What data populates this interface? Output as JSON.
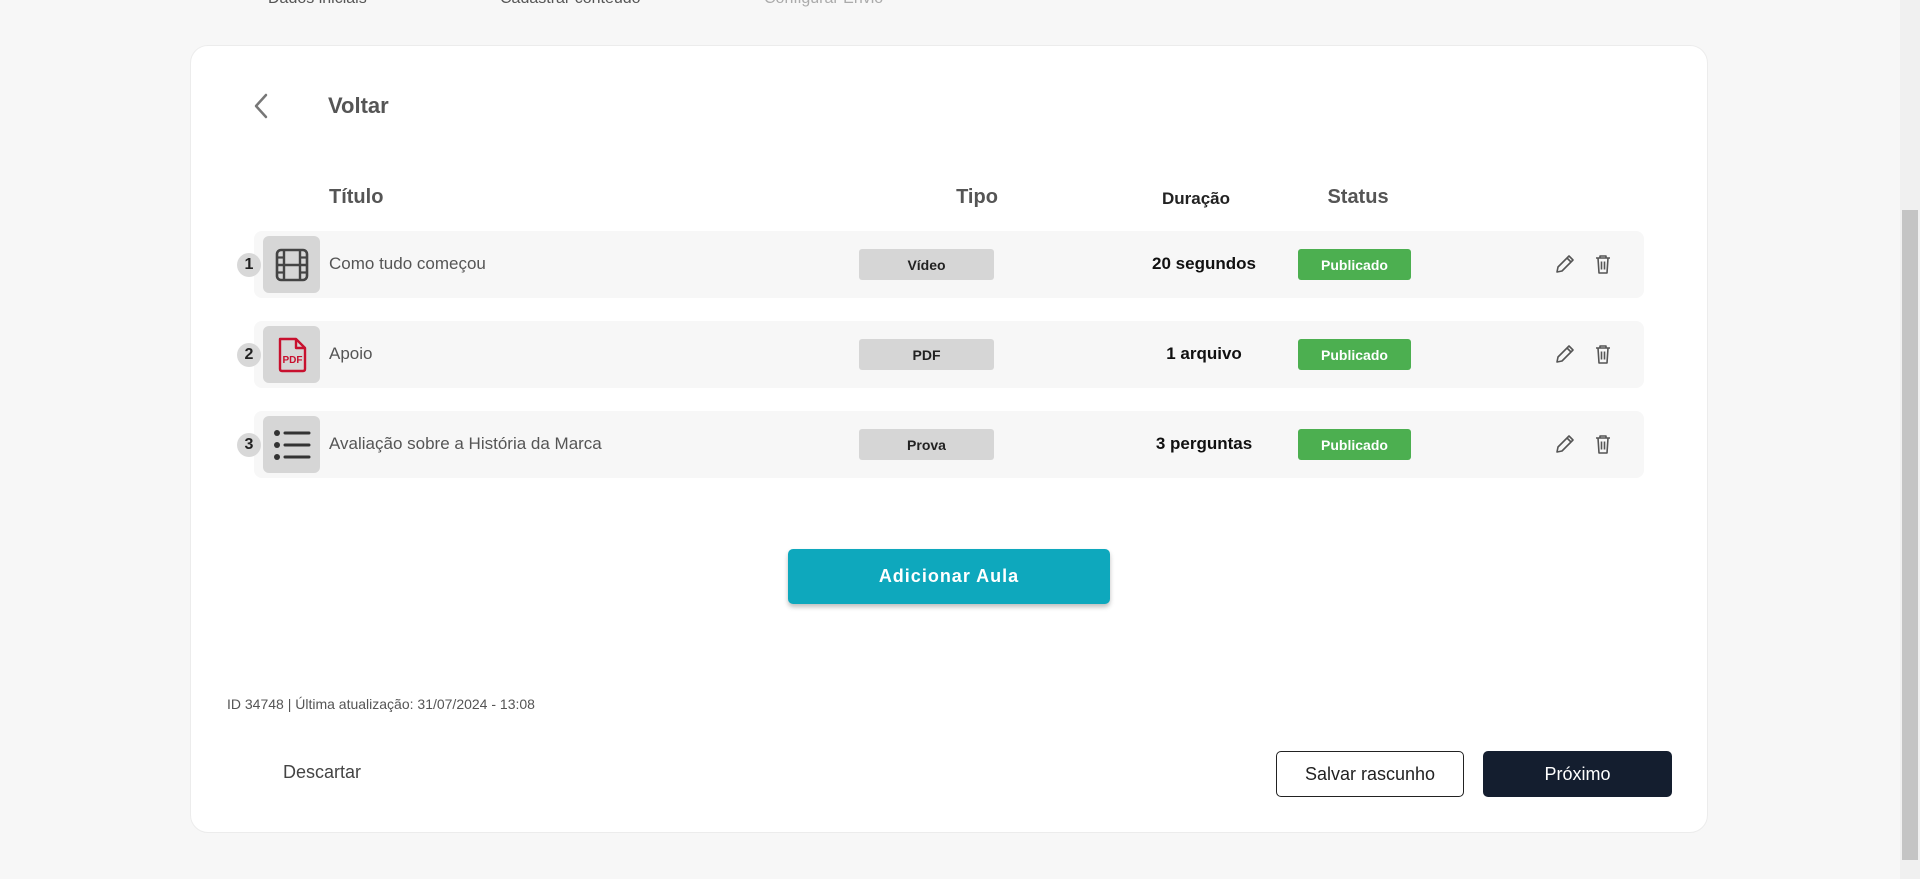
{
  "stepper": {
    "steps": [
      {
        "label": "Dados iniciais"
      },
      {
        "label": "Cadastrar conteúdo"
      },
      {
        "label": "Configurar Envio"
      }
    ]
  },
  "back": {
    "label": "Voltar",
    "icon": "chevron-left-icon"
  },
  "table": {
    "headers": {
      "title": "Título",
      "type": "Tipo",
      "duration": "Duração",
      "status": "Status"
    },
    "rows": [
      {
        "number": "1",
        "icon": "film-icon",
        "title": "Como tudo começou",
        "type": "Vídeo",
        "duration": "20 segundos",
        "status": "Publicado"
      },
      {
        "number": "2",
        "icon": "pdf-icon",
        "title": "Apoio",
        "type": "PDF",
        "duration": "1 arquivo",
        "status": "Publicado"
      },
      {
        "number": "3",
        "icon": "list-icon",
        "title": "Avaliação sobre a História da Marca",
        "type": "Prova",
        "duration": "3 perguntas",
        "status": "Publicado"
      }
    ]
  },
  "actions": {
    "add_lesson": "Adicionar Aula"
  },
  "meta": {
    "text": "ID 34748 | Última atualização: 31/07/2024 - 13:08"
  },
  "footer": {
    "discard": "Descartar",
    "save_draft": "Salvar rascunho",
    "next": "Próximo"
  },
  "colors": {
    "accent": "#0ea8bd",
    "published": "#4caf50",
    "primary_dark": "#141e2f",
    "pdf_red": "#c8102e"
  }
}
